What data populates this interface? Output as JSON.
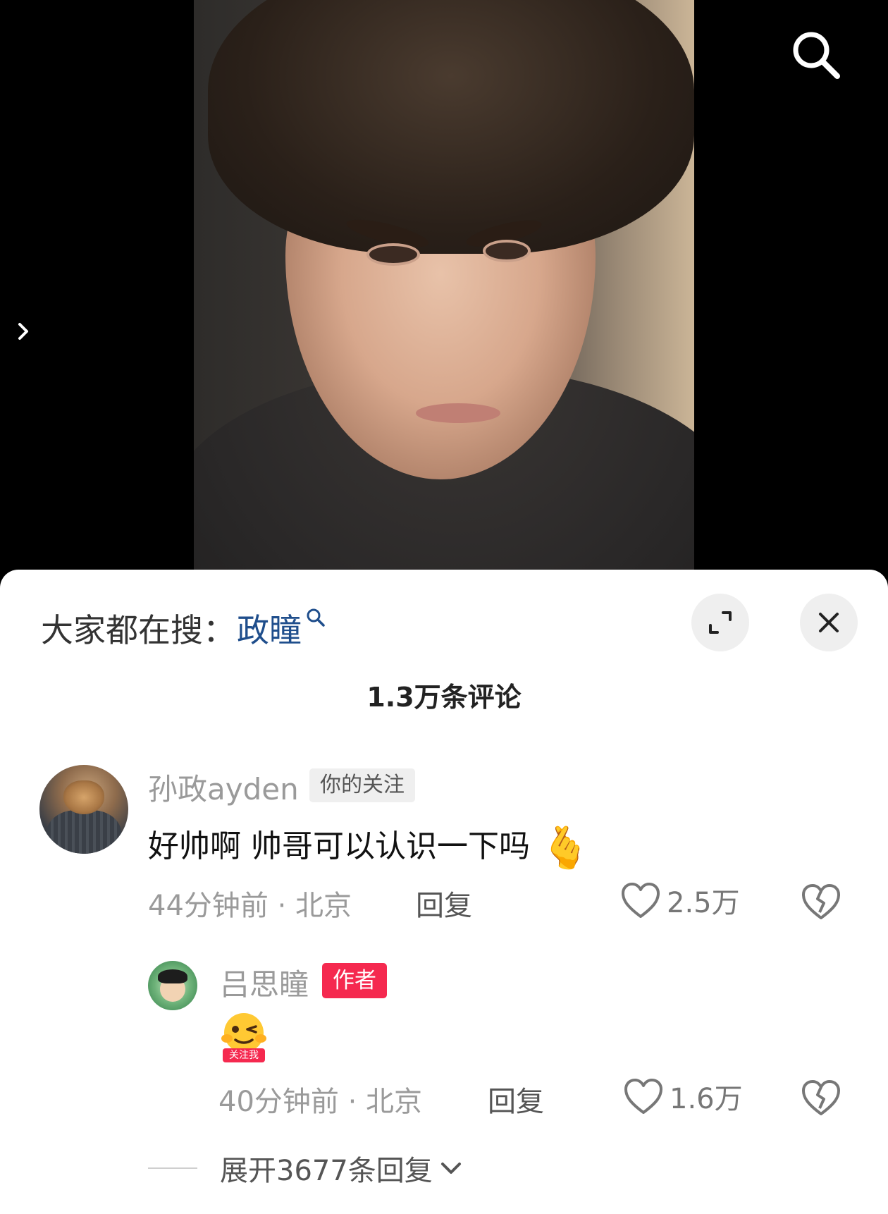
{
  "video": {
    "search_icon": "search-icon",
    "side_arrow_icon": "chevron-right-icon"
  },
  "sheet": {
    "hot_search_label": "大家都在搜：",
    "hot_search_keyword": "政瞳",
    "comment_count": "1.3万条评论",
    "expand_icon": "expand-icon",
    "close_icon": "close-icon"
  },
  "comments": [
    {
      "username": "孙政ayden",
      "tag": "你的关注",
      "text": "好帅啊 帅哥可以认识一下吗",
      "emoji": "🫰",
      "time_location": "44分钟前 · 北京",
      "reply_label": "回复",
      "likes": "2.5万"
    }
  ],
  "replies": [
    {
      "username": "吕思瞳",
      "tag": "作者",
      "sticker_text": "关注我",
      "time_location": "40分钟前 · 北京",
      "reply_label": "回复",
      "likes": "1.6万"
    }
  ],
  "expand_replies": {
    "label": "展开3677条回复"
  },
  "colors": {
    "author_tag": "#f5294f",
    "keyword": "#1f4e8c",
    "meta_text": "#9a9a9a"
  }
}
